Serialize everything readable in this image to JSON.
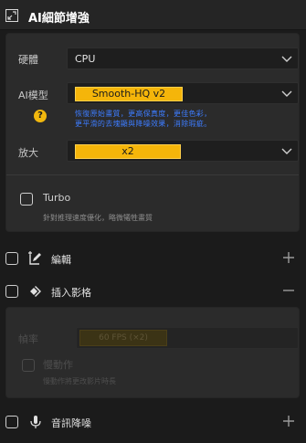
{
  "header": {
    "title": "AI細節增強",
    "icon": "expand-icon"
  },
  "ai_panel": {
    "hardware": {
      "label": "硬體",
      "value": "CPU"
    },
    "model": {
      "label": "AI模型",
      "value": "Smooth-HQ  v2",
      "desc_line1": "恢復原始畫質，更高保真度，更佳色彩，",
      "desc_line2": "更平滑的去塊顯與降噪效果，消除瑕疵。"
    },
    "scale": {
      "label": "放大",
      "value": "x2"
    },
    "turbo": {
      "label": "Turbo",
      "desc": "針對推理速度優化，略微犧牲畫質",
      "checked": false
    }
  },
  "sections": {
    "edit": {
      "label": "編輯",
      "icon": "edit-icon",
      "expanded": false
    },
    "insert": {
      "label": "插入影格",
      "icon": "insert-frames-icon",
      "expanded": true
    },
    "denoise": {
      "label": "音訊降噪",
      "icon": "microphone-icon",
      "expanded": false
    }
  },
  "insert_panel": {
    "frame_rate_label": "幀率",
    "frame_rate_value": "60 FPS (×2)",
    "slow_motion_label": "慢動作",
    "slow_motion_desc": "慢動作將更改影片時長"
  },
  "colors": {
    "accent": "#f5b50a",
    "link_blue": "#3d7cff",
    "bg": "#1b1b1b",
    "panel": "#2b2b2b"
  }
}
